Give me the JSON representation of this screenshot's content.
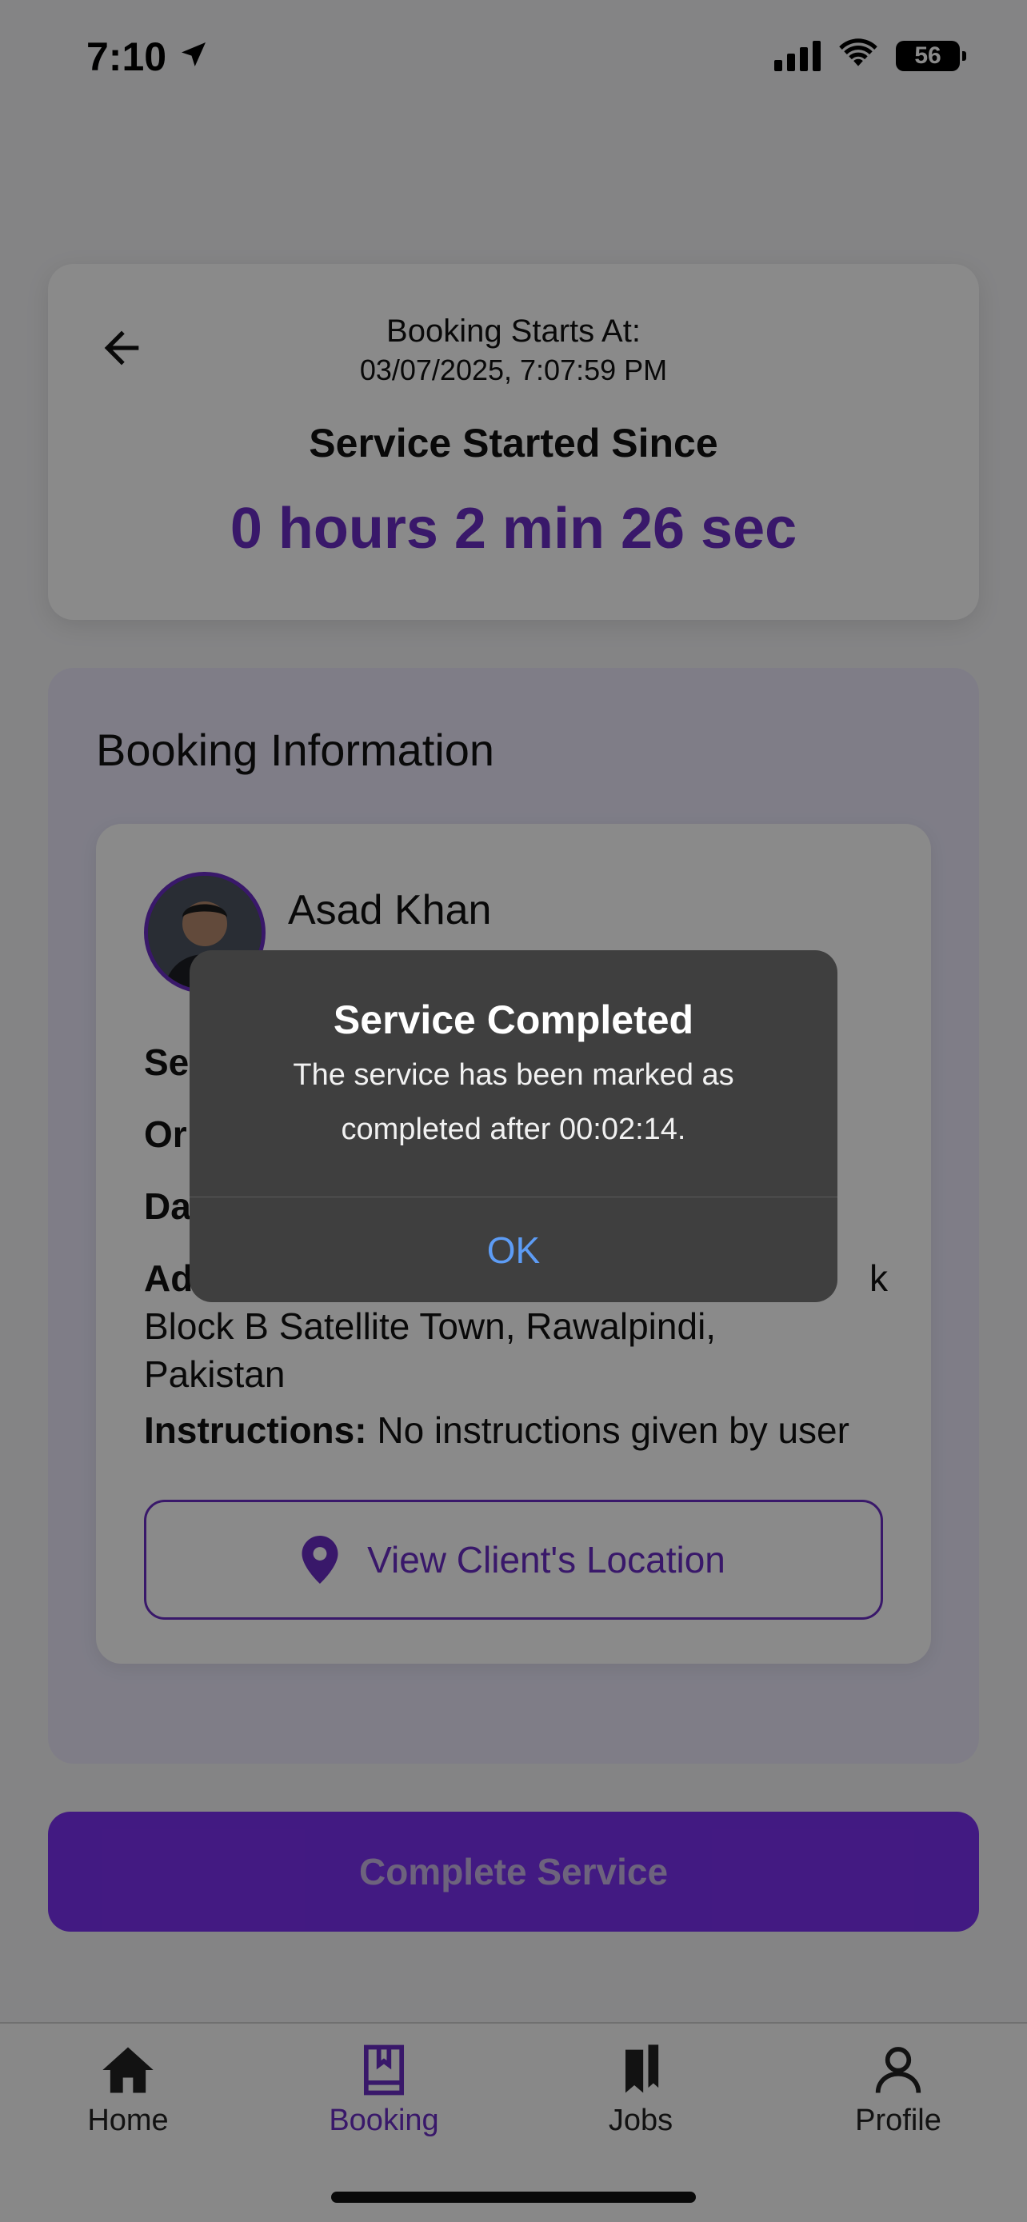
{
  "status_bar": {
    "time": "7:10",
    "battery": "56"
  },
  "header": {
    "starts_label": "Booking Starts At:",
    "starts_value": "03/07/2025, 7:07:59 PM",
    "since_label": "Service Started Since",
    "timer": "0 hours 2 min 26 sec"
  },
  "booking_info": {
    "title": "Booking Information",
    "client_name": "Asad Khan",
    "client_sub": "",
    "fields": {
      "service_label": "Se",
      "order_label": "Or",
      "date_label": "Da",
      "address_label": "Ad",
      "address_tail_char": "k",
      "address_line2": "Block B Satellite Town, Rawalpindi,",
      "address_line3": "Pakistan",
      "instructions_label": "Instructions:",
      "instructions_value": "No instructions given by user"
    },
    "location_button": "View Client's Location"
  },
  "complete_button": "Complete Service",
  "tabs": [
    {
      "label": "Home",
      "icon": "home-icon"
    },
    {
      "label": "Booking",
      "icon": "book-icon",
      "active": true
    },
    {
      "label": "Jobs",
      "icon": "bookmarks-icon"
    },
    {
      "label": "Profile",
      "icon": "person-icon"
    }
  ],
  "alert": {
    "title": "Service Completed",
    "message": "The service has been marked as completed after 00:02:14.",
    "ok": "OK"
  },
  "colors": {
    "accent": "#6a2ec4",
    "button": "#7b30f0",
    "alert_bg": "#3f3f3f",
    "alert_link": "#5d9cf5"
  }
}
